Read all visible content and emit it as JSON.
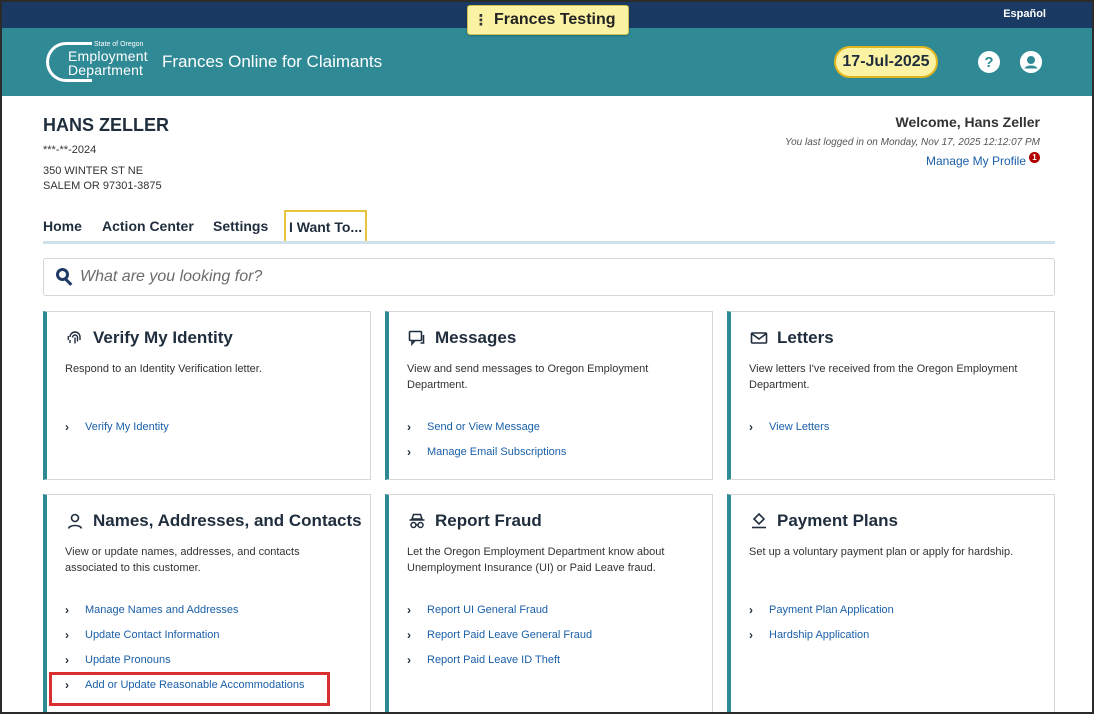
{
  "top_strip": {
    "language_link": "Español"
  },
  "env_banner": {
    "menu_glyph": "⋮",
    "title": "Frances Testing"
  },
  "header": {
    "logo": {
      "small": "State of Oregon",
      "line1": "Employment",
      "line2": "Department"
    },
    "app_title": "Frances Online for Claimants",
    "date": "17-Jul-2025",
    "help_glyph": "?",
    "user_icon": "user-icon"
  },
  "customer": {
    "name": "HANS ZELLER",
    "ssn": "***-**-2024",
    "address1": "350 WINTER ST NE",
    "address2": "SALEM OR 97301-3875"
  },
  "welcome": {
    "text": "Welcome, Hans Zeller",
    "last_login": "You last logged in on Monday, Nov 17, 2025 12:12:07 PM",
    "manage_profile": "Manage My Profile",
    "badge": "1"
  },
  "nav": {
    "tabs": [
      {
        "label": "Home"
      },
      {
        "label": "Action Center"
      },
      {
        "label": "Settings"
      },
      {
        "label": "I Want To..."
      }
    ],
    "active": "I Want To..."
  },
  "search": {
    "placeholder": "What are you looking for?"
  },
  "cards": [
    {
      "title": "Verify My Identity",
      "icon": "fingerprint-icon",
      "description": "Respond to an Identity Verification letter.",
      "links": [
        "Verify My Identity"
      ]
    },
    {
      "title": "Messages",
      "icon": "message-icon",
      "description": "View and send messages to Oregon Employment Department.",
      "links": [
        "Send or View Message",
        "Manage Email Subscriptions"
      ]
    },
    {
      "title": "Letters",
      "icon": "envelope-icon",
      "description": "View letters I've received from the Oregon Employment Department.",
      "links": [
        "View Letters"
      ]
    },
    {
      "title": "Names, Addresses, and Contacts",
      "icon": "person-icon",
      "description": "View or update names, addresses, and contacts associated to this customer.",
      "links": [
        "Manage Names and Addresses",
        "Update Contact Information",
        "Update Pronouns",
        "Add or Update Reasonable Accommodations"
      ]
    },
    {
      "title": "Report Fraud",
      "icon": "detective-icon",
      "description": "Let the Oregon Employment Department know about Unemployment Insurance (UI) or Paid Leave fraud.",
      "links": [
        "Report UI General Fraud",
        "Report Paid Leave General Fraud",
        "Report Paid Leave ID Theft"
      ]
    },
    {
      "title": "Payment Plans",
      "icon": "payment-icon",
      "description": "Set up a voluntary payment plan or apply for hardship.",
      "links": [
        "Payment Plan Application",
        "Hardship Application"
      ]
    }
  ],
  "colors": {
    "teal": "#2f8a96",
    "navy": "#1a3a63",
    "highlight": "#d9302f",
    "date_bg": "#fbf3a3"
  }
}
